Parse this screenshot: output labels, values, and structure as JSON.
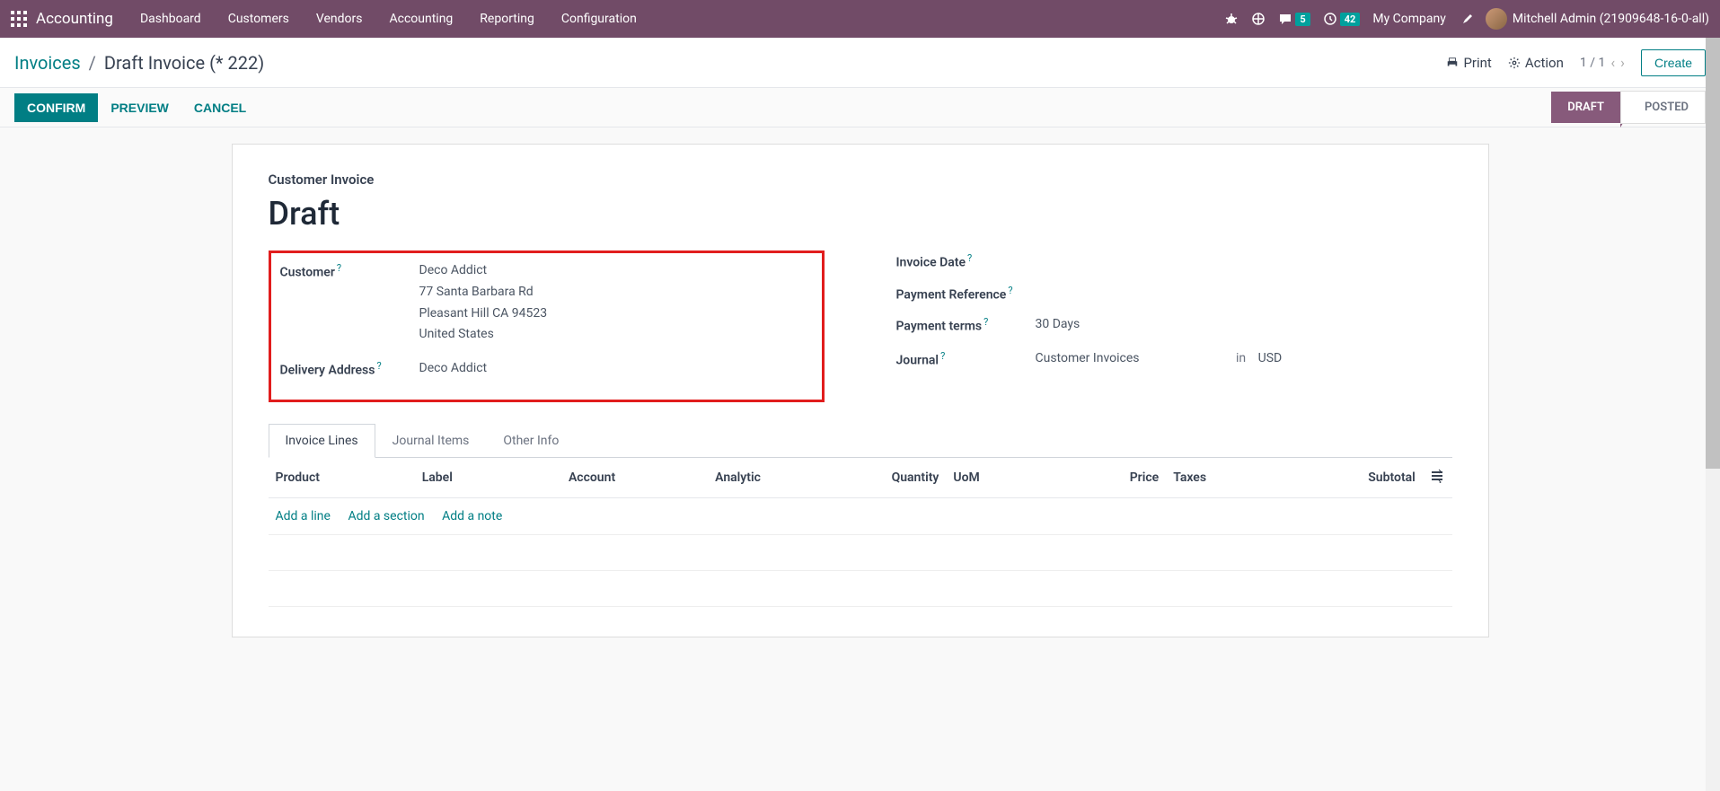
{
  "navbar": {
    "brand": "Accounting",
    "menu": [
      "Dashboard",
      "Customers",
      "Vendors",
      "Accounting",
      "Reporting",
      "Configuration"
    ],
    "messages_count": "5",
    "activities_count": "42",
    "company": "My Company",
    "user": "Mitchell Admin (21909648-16-0-all)"
  },
  "breadcrumb": {
    "parent": "Invoices",
    "current": "Draft Invoice (* 222)",
    "print": "Print",
    "action": "Action",
    "pager": "1 / 1",
    "create": "Create"
  },
  "statusbar": {
    "confirm": "CONFIRM",
    "preview": "PREVIEW",
    "cancel": "CANCEL",
    "draft": "DRAFT",
    "posted": "POSTED"
  },
  "form": {
    "subtitle": "Customer Invoice",
    "title": "Draft",
    "left": {
      "customer_label": "Customer",
      "customer_name": "Deco Addict",
      "customer_addr1": "77 Santa Barbara Rd",
      "customer_addr2": "Pleasant Hill CA 94523",
      "customer_addr3": "United States",
      "delivery_label": "Delivery Address",
      "delivery_value": "Deco Addict"
    },
    "right": {
      "invoice_date_label": "Invoice Date",
      "payment_ref_label": "Payment Reference",
      "payment_terms_label": "Payment terms",
      "payment_terms_value": "30 Days",
      "journal_label": "Journal",
      "journal_value": "Customer Invoices",
      "journal_in": "in",
      "journal_currency": "USD"
    }
  },
  "tabs": {
    "t1": "Invoice Lines",
    "t2": "Journal Items",
    "t3": "Other Info"
  },
  "columns": {
    "product": "Product",
    "label": "Label",
    "account": "Account",
    "analytic": "Analytic",
    "quantity": "Quantity",
    "uom": "UoM",
    "price": "Price",
    "taxes": "Taxes",
    "subtotal": "Subtotal"
  },
  "line_actions": {
    "add_line": "Add a line",
    "add_section": "Add a section",
    "add_note": "Add a note"
  },
  "help": "?"
}
